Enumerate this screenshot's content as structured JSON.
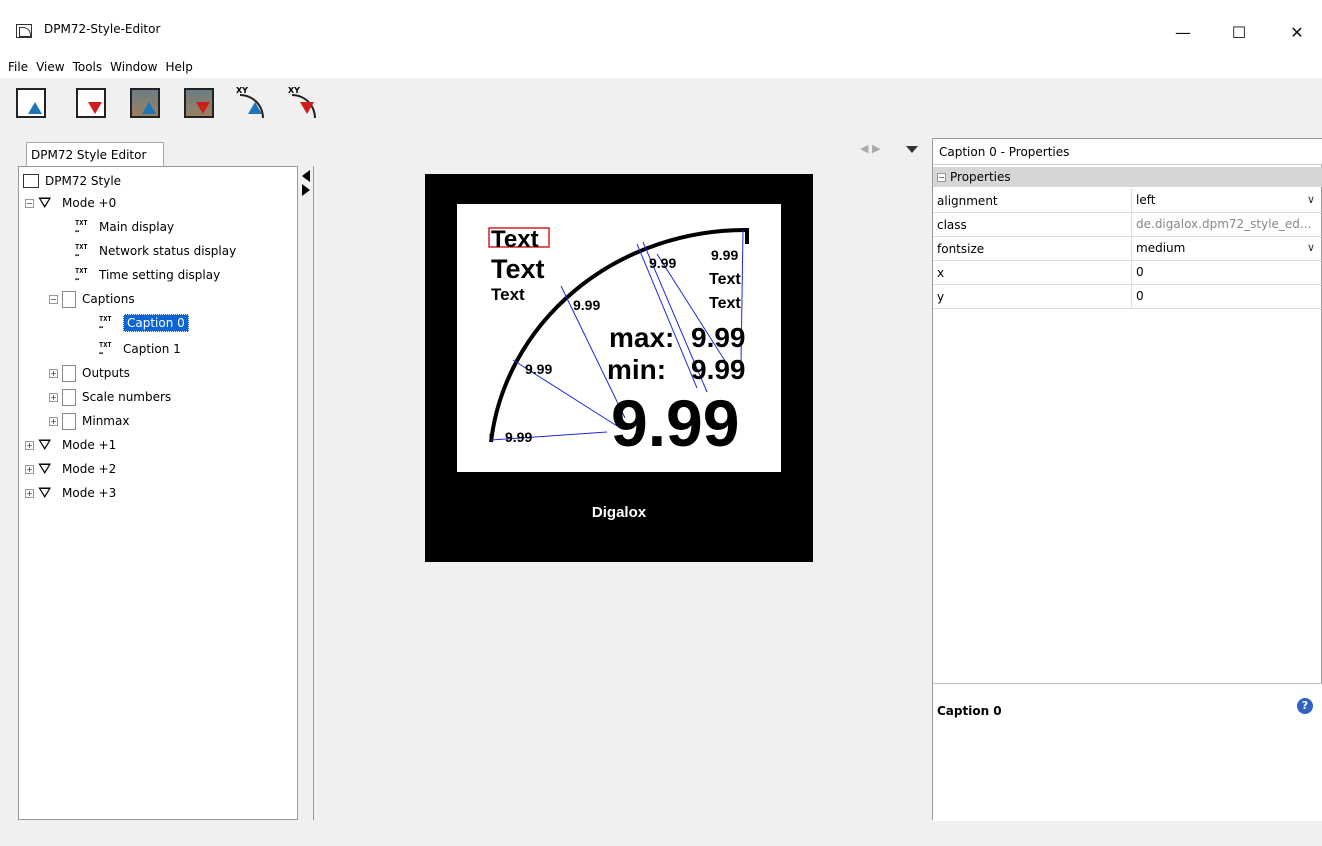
{
  "window": {
    "title": "DPM72-Style-Editor",
    "min": "—",
    "max": "☐",
    "close": "✕"
  },
  "menu": [
    "File",
    "View",
    "Tools",
    "Window",
    "Help"
  ],
  "toolbar": {
    "xy1": "XY",
    "xy2": "XY"
  },
  "tab": {
    "label": "DPM72 Style Editor"
  },
  "tree": {
    "root": "DPM72 Style",
    "mode0": "Mode +0",
    "main_display": "Main display",
    "network_status": "Network status display",
    "time_setting": "Time setting display",
    "captions": "Captions",
    "caption0": "Caption 0",
    "caption1": "Caption 1",
    "outputs": "Outputs",
    "scale_numbers": "Scale numbers",
    "minmax": "Minmax",
    "mode1": "Mode +1",
    "mode2": "Mode +2",
    "mode3": "Mode +3"
  },
  "display": {
    "text_a": "Text",
    "text_b": "Text",
    "text_c": "Text",
    "text_d": "Text",
    "text_e": "Text",
    "scale_1": "9.99",
    "scale_2": "9.99",
    "scale_3": "9.99",
    "scale_4": "9.99",
    "scale_5": "9.99",
    "max_label": "max:",
    "max_value": "9.99",
    "min_label": "min:",
    "min_value": "9.99",
    "main_value": "9.99",
    "brand": "Digalox"
  },
  "properties": {
    "title": "Caption 0 - Properties",
    "group": "Properties",
    "rows": [
      {
        "key": "alignment",
        "value": "left"
      },
      {
        "key": "class",
        "value": "de.digalox.dpm72_style_ed..."
      },
      {
        "key": "fontsize",
        "value": "medium"
      },
      {
        "key": "x",
        "value": "0"
      },
      {
        "key": "y",
        "value": "0"
      }
    ],
    "description_title": "Caption 0",
    "help": "?"
  },
  "colors": {
    "selection": "#0a64d6",
    "leader": "#1a2bd6",
    "caption_box": "#d42222"
  }
}
